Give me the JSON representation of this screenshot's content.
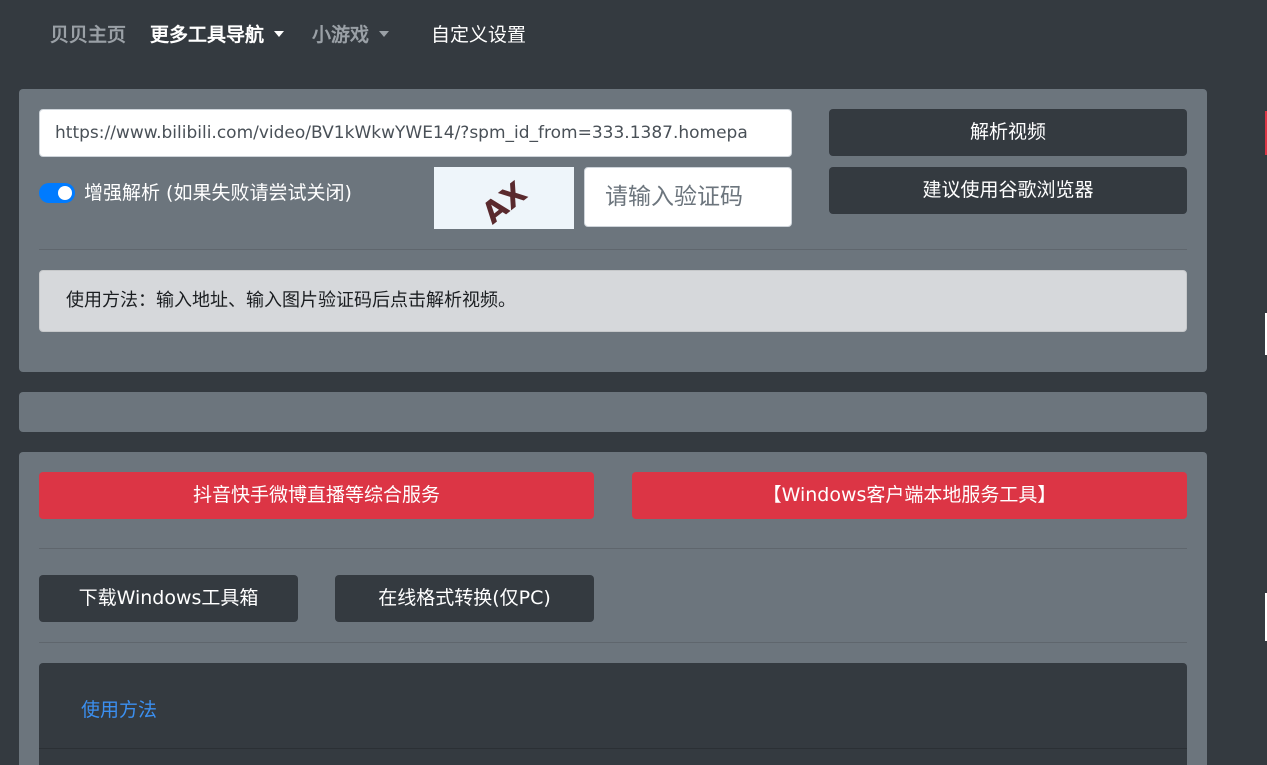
{
  "nav": {
    "home": "贝贝主页",
    "more_tools": "更多工具导航",
    "mini_games": "小游戏",
    "custom_settings": "自定义设置"
  },
  "parser": {
    "url_value": "https://www.bilibili.com/video/BV1kWkwYWE14/?spm_id_from=333.1387.homepa",
    "parse_button": "解析视频",
    "browser_tip_button": "建议使用谷歌浏览器",
    "enhanced_toggle_label": "增强解析 (如果失败请尝试关闭)",
    "enhanced_toggle_on": true,
    "captcha_text": "AX",
    "captcha_placeholder": "请输入验证码",
    "usage_alert": "使用方法：输入地址、输入图片验证码后点击解析视频。"
  },
  "services": {
    "douyin_button": "抖音快手微博直播等综合服务",
    "windows_client_button": "【Windows客户端本地服务工具】",
    "download_toolbox_button": "下载Windows工具箱",
    "format_convert_button": "在线格式转换(仅PC)",
    "usage_link": "使用方法"
  },
  "colors": {
    "background": "#343a40",
    "panel": "#6c757d",
    "danger": "#dc3545",
    "primary": "#007bff",
    "link": "#3b8ff0"
  }
}
